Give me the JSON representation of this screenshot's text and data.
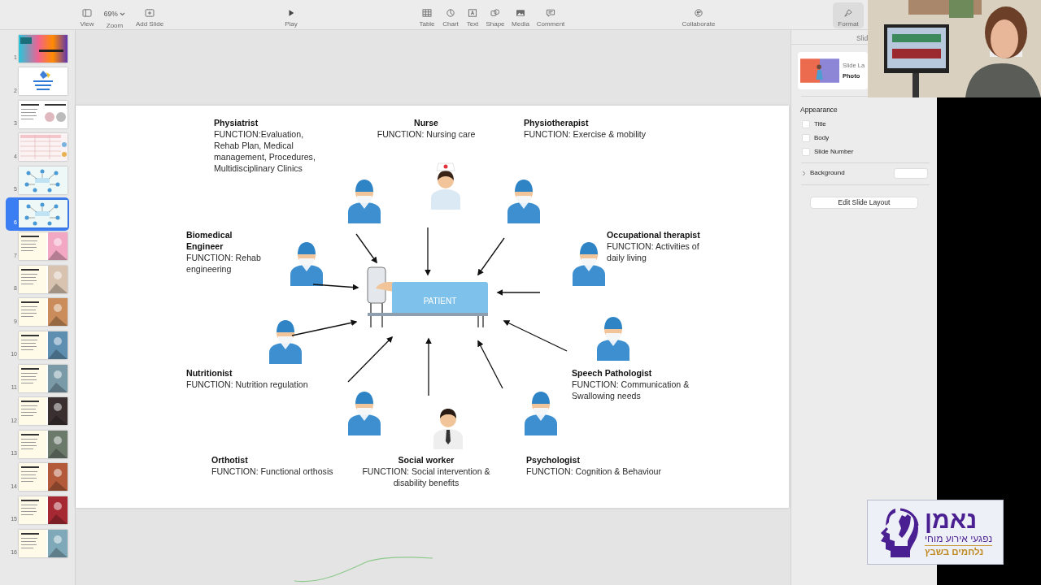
{
  "toolbar": {
    "items": [
      {
        "label": "View",
        "kind": "sidebar",
        "selected": false
      },
      {
        "label": "Zoom",
        "value": "69%",
        "selected": false
      },
      {
        "label": "Add Slide",
        "kind": "add",
        "selected": false
      },
      {
        "label": "Play",
        "kind": "play",
        "selected": false
      },
      {
        "label": "Table",
        "kind": "table",
        "selected": false
      },
      {
        "label": "Chart",
        "kind": "chart",
        "selected": false
      },
      {
        "label": "Text",
        "kind": "text",
        "selected": false
      },
      {
        "label": "Shape",
        "kind": "shape",
        "selected": false
      },
      {
        "label": "Media",
        "kind": "media",
        "selected": false
      },
      {
        "label": "Comment",
        "kind": "comment",
        "selected": false
      },
      {
        "label": "Collaborate",
        "kind": "collaborate",
        "selected": false
      },
      {
        "label": "Format",
        "kind": "format",
        "selected": true
      }
    ]
  },
  "slides": [
    {
      "number": "1",
      "kind": "title",
      "selected": false
    },
    {
      "number": "2",
      "kind": "logo",
      "selected": false
    },
    {
      "number": "3",
      "kind": "text",
      "selected": false
    },
    {
      "number": "4",
      "kind": "table",
      "selected": false
    },
    {
      "number": "5",
      "kind": "diagram",
      "selected": false
    },
    {
      "number": "6",
      "kind": "diagram",
      "selected": true
    },
    {
      "number": "7",
      "selected": false
    },
    {
      "number": "8",
      "selected": false
    },
    {
      "number": "9",
      "selected": false
    },
    {
      "number": "10",
      "selected": false
    },
    {
      "number": "11",
      "selected": false
    },
    {
      "number": "12",
      "selected": false
    },
    {
      "number": "13",
      "selected": false
    },
    {
      "number": "14",
      "selected": false
    },
    {
      "number": "15",
      "selected": false
    },
    {
      "number": "16",
      "selected": false
    }
  ],
  "slide": {
    "patient_label": "PATIENT",
    "figures": [
      {
        "kind": "doctor"
      },
      {
        "kind": "nurse"
      },
      {
        "kind": "doctor"
      },
      {
        "kind": "doctor"
      },
      {
        "kind": "doctor"
      },
      {
        "kind": "doctor"
      },
      {
        "kind": "doctor"
      },
      {
        "kind": "doctor"
      },
      {
        "kind": "social"
      },
      {
        "kind": "doctor"
      }
    ],
    "roles": [
      {
        "title": "Physiatrist",
        "function": "FUNCTION:Evaluation, Rehab Plan, Medical management, Procedures, Multidisciplinary Clinics"
      },
      {
        "title": "Nurse",
        "function": "FUNCTION: Nursing care"
      },
      {
        "title": "Physiotherapist",
        "function": "FUNCTION: Exercise & mobility"
      },
      {
        "title": "Biomedical Engineer",
        "function": "FUNCTION: Rehab engineering"
      },
      {
        "title": "Occupational therapist",
        "function": "FUNCTION: Activities of daily living"
      },
      {
        "title": "Nutritionist",
        "function": "FUNCTION: Nutrition regulation"
      },
      {
        "title": "Speech Pathologist",
        "function": "FUNCTION: Communication & Swallowing needs"
      },
      {
        "title": "Orthotist",
        "function": "FUNCTION: Functional orthosis"
      },
      {
        "title": "Social worker",
        "function": "FUNCTION: Social intervention & disability benefits"
      },
      {
        "title": "Psychologist",
        "function": "FUNCTION: Cognition & Behaviour"
      }
    ]
  },
  "inspector": {
    "tab": "Slid",
    "layout": {
      "name": "Slide La",
      "value": "Photo"
    },
    "appearance": {
      "heading": "Appearance",
      "options": [
        {
          "label": "Title",
          "checked": false
        },
        {
          "label": "Body",
          "checked": false
        },
        {
          "label": "Slide Number",
          "checked": false
        }
      ]
    },
    "background": {
      "label": "Background",
      "expanded": false
    },
    "edit_button": "Edit Slide Layout"
  },
  "logo": {
    "name": "נאמן",
    "subtitle": "נפגעי אירוע מוחי",
    "slogan": "נלחמים בשבץ"
  }
}
